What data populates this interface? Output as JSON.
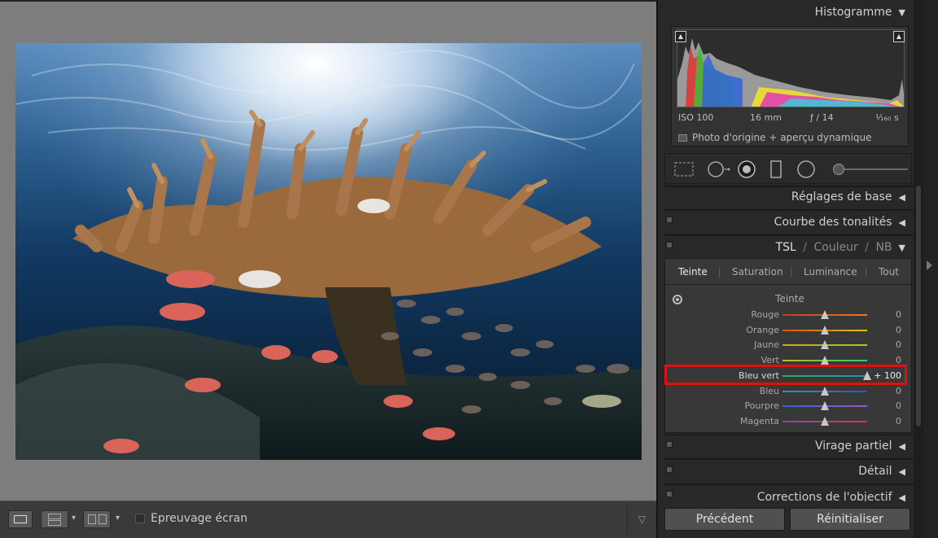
{
  "toolbar": {
    "proof_label": "Epreuvage écran"
  },
  "histogram": {
    "title": "Histogramme",
    "iso": "ISO 100",
    "focal": "16 mm",
    "aperture": "ƒ / 14",
    "shutter": "¹⁄₁₆₀ s",
    "preview_label": "Photo d'origine + aperçu dynamique"
  },
  "sections": {
    "basic": "Réglages de base",
    "tone_curve": "Courbe des tonalités",
    "split_toning": "Virage partiel",
    "detail": "Détail",
    "lens": "Corrections de l'objectif"
  },
  "tsl": {
    "header_tsl": "TSL",
    "header_sep1": "/",
    "header_color": "Couleur",
    "header_sep2": "/",
    "header_nb": "NB",
    "tabs": [
      "Teinte",
      "Saturation",
      "Luminance",
      "Tout"
    ],
    "active_tab": "Teinte",
    "subpanel_title": "Teinte",
    "rows": [
      {
        "label": "Rouge",
        "value": "0",
        "level": 0,
        "color_a": "#c0392b",
        "color_b": "#e67e22"
      },
      {
        "label": "Orange",
        "value": "0",
        "level": 0,
        "color_a": "#d35400",
        "color_b": "#e0c020"
      },
      {
        "label": "Jaune",
        "value": "0",
        "level": 0,
        "color_a": "#d4a017",
        "color_b": "#9acd32"
      },
      {
        "label": "Vert",
        "value": "0",
        "level": 0,
        "color_a": "#b8c020",
        "color_b": "#2ecc71"
      },
      {
        "label": "Bleu vert",
        "value": "+ 100",
        "level": 100,
        "color_a": "#27ae60",
        "color_b": "#1e90c0"
      },
      {
        "label": "Bleu",
        "value": "0",
        "level": 0,
        "color_a": "#1ea0a0",
        "color_b": "#3050d0"
      },
      {
        "label": "Pourpre",
        "value": "0",
        "level": 0,
        "color_a": "#2a6ad0",
        "color_b": "#9b59b6"
      },
      {
        "label": "Magenta",
        "value": "0",
        "level": 0,
        "color_a": "#8e44ad",
        "color_b": "#e0305a"
      }
    ]
  },
  "nav": {
    "previous": "Précédent",
    "reset": "Réinitialiser"
  },
  "accents": {
    "highlight": "#e01010"
  }
}
